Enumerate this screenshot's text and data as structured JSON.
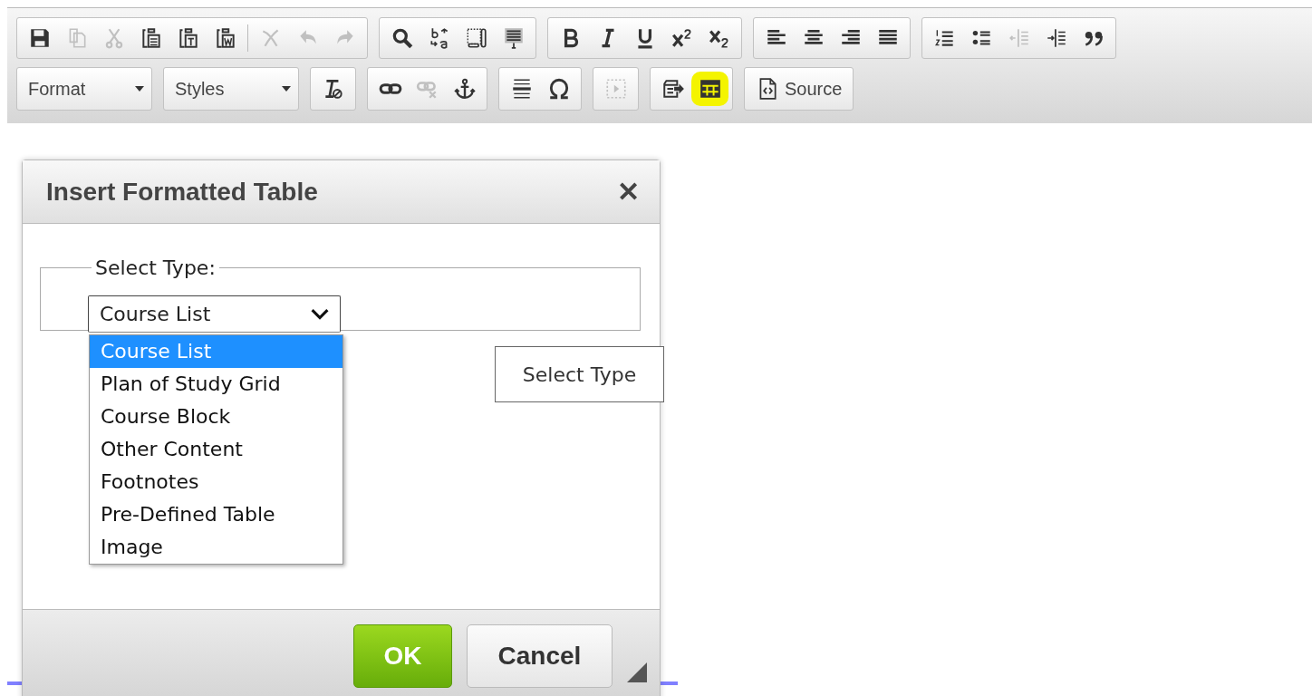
{
  "toolbar": {
    "rows": [
      {
        "groups": [
          {
            "items": [
              {
                "kind": "save",
                "disabled": false
              },
              {
                "kind": "copy",
                "disabled": true
              },
              {
                "kind": "cut",
                "disabled": true
              },
              {
                "kind": "paste",
                "disabled": false
              },
              {
                "kind": "paste-text",
                "disabled": false
              },
              {
                "kind": "paste-word",
                "disabled": false
              },
              {
                "kind": "separator"
              },
              {
                "kind": "cross",
                "disabled": true
              },
              {
                "kind": "undo",
                "disabled": true
              },
              {
                "kind": "redo",
                "disabled": true
              }
            ]
          },
          {
            "items": [
              {
                "kind": "search",
                "disabled": false
              },
              {
                "kind": "replace",
                "disabled": false
              },
              {
                "kind": "select-all",
                "disabled": false
              },
              {
                "kind": "spellcheck",
                "disabled": false
              }
            ]
          },
          {
            "items": [
              {
                "kind": "bold",
                "disabled": false
              },
              {
                "kind": "italic",
                "disabled": false
              },
              {
                "kind": "underline",
                "disabled": false
              },
              {
                "kind": "superscript",
                "disabled": false
              },
              {
                "kind": "subscript",
                "disabled": false
              }
            ]
          },
          {
            "items": [
              {
                "kind": "align-left",
                "disabled": false
              },
              {
                "kind": "align-center",
                "disabled": false
              },
              {
                "kind": "align-right",
                "disabled": false
              },
              {
                "kind": "justify",
                "disabled": false
              }
            ]
          },
          {
            "items": [
              {
                "kind": "numbered-list",
                "disabled": false
              },
              {
                "kind": "bulleted-list",
                "disabled": false
              },
              {
                "kind": "outdent",
                "disabled": true
              },
              {
                "kind": "indent",
                "disabled": false
              },
              {
                "kind": "quote",
                "disabled": false
              }
            ]
          }
        ]
      },
      {
        "groups": [
          {
            "items": [
              {
                "kind": "combo",
                "label": "Format"
              }
            ]
          },
          {
            "items": [
              {
                "kind": "combo",
                "label": "Styles"
              }
            ]
          },
          {
            "items": [
              {
                "kind": "clear-format",
                "disabled": false
              }
            ]
          },
          {
            "items": [
              {
                "kind": "link",
                "disabled": false
              },
              {
                "kind": "unlink",
                "disabled": true
              },
              {
                "kind": "anchor",
                "disabled": false
              }
            ]
          },
          {
            "items": [
              {
                "kind": "horizontal-rule",
                "disabled": false
              },
              {
                "kind": "omega",
                "disabled": false
              }
            ]
          },
          {
            "items": [
              {
                "kind": "iframe",
                "disabled": true
              }
            ]
          },
          {
            "items": [
              {
                "kind": "template",
                "disabled": false
              },
              {
                "kind": "table",
                "disabled": false,
                "highlighted": true
              }
            ]
          },
          {
            "items": [
              {
                "kind": "source",
                "label": "Source",
                "disabled": false
              }
            ]
          }
        ]
      }
    ]
  },
  "dialog": {
    "title": "Insert Formatted Table",
    "close": "✕",
    "fieldset": {
      "legend": "Select Type:",
      "select": {
        "value": "Course List",
        "expanded": true,
        "options": [
          {
            "label": "Course List",
            "selected": true
          },
          {
            "label": "Plan of Study Grid",
            "selected": false
          },
          {
            "label": "Course Block",
            "selected": false
          },
          {
            "label": "Other Content",
            "selected": false
          },
          {
            "label": "Footnotes",
            "selected": false
          },
          {
            "label": "Pre-Defined Table",
            "selected": false
          },
          {
            "label": "Image",
            "selected": false
          }
        ]
      }
    },
    "tooltip": "Select Type",
    "buttons": [
      {
        "label": "OK",
        "kind": "primary"
      },
      {
        "label": "Cancel",
        "kind": "secondary"
      }
    ]
  }
}
